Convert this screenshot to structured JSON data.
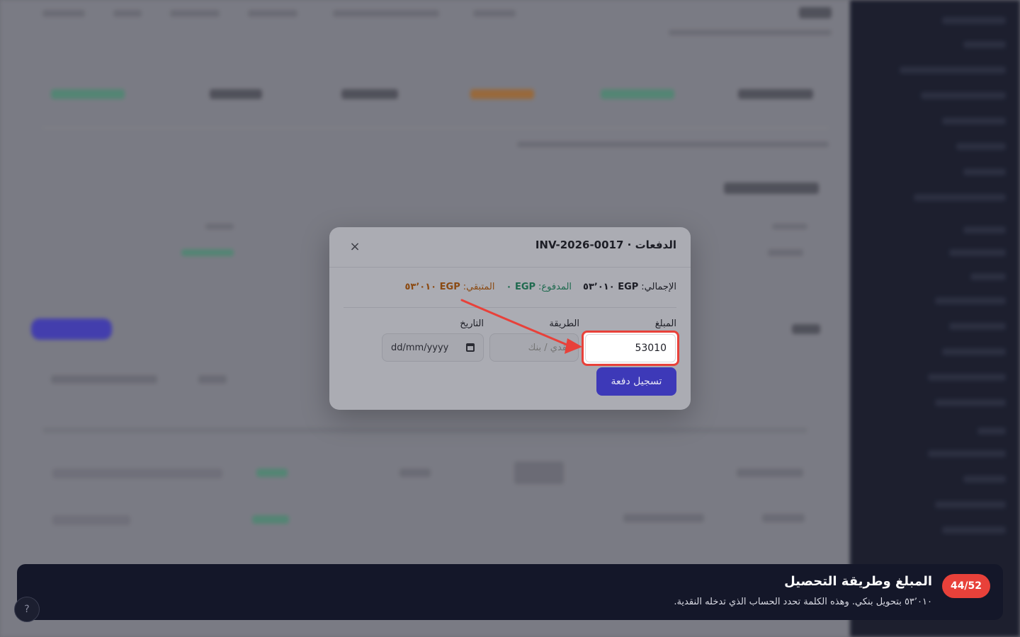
{
  "modal": {
    "title": "الدفعات · INV-2026-0017",
    "close_icon": "×",
    "summary": {
      "total_label": "الإجمالي:",
      "total_value": "EGP ٥٣٬٠١٠",
      "paid_label": "المدفوع:",
      "paid_value": "EGP ٠",
      "remaining_label": "المتبقي:",
      "remaining_value": "EGP ٥٣٬٠١٠"
    },
    "fields": {
      "amount_label": "المبلغ",
      "amount_value": "53010",
      "method_label": "الطريقة",
      "method_placeholder": "نقدي / بنك",
      "date_label": "التاريخ",
      "date_placeholder": "dd/mm/yyyy"
    },
    "submit_label": "تسجيل دفعة"
  },
  "tour": {
    "step_counter": "44/52",
    "title": "المبلغ وطريقة التحصيل",
    "body": "٥٣٬٠١٠ بتحويل بنكي. وهذه الكلمة تحدد الحساب الذي تدخله النقدية."
  },
  "colors": {
    "highlight": "#e8413a",
    "primary": "#3d39b8",
    "paid": "#1f6a4f",
    "remaining": "#8b4a12",
    "tour_bg": "#141729"
  },
  "icons": {
    "close": "close-icon",
    "calendar": "calendar-icon",
    "arrow": "pointer-arrow-icon"
  }
}
